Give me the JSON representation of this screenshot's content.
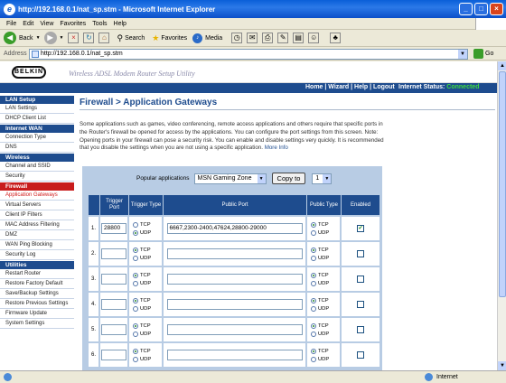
{
  "window": {
    "title": "http://192.168.0.1/nat_sp.stm - Microsoft Internet Explorer",
    "min": "_",
    "max": "□",
    "close": "×"
  },
  "menu": [
    "File",
    "Edit",
    "View",
    "Favorites",
    "Tools",
    "Help"
  ],
  "toolbar": {
    "back": "Back",
    "search": "Search",
    "favorites": "Favorites",
    "media": "Media"
  },
  "address": {
    "label": "Address",
    "url": "http://192.168.0.1/nat_sp.stm",
    "go": "Go"
  },
  "status": {
    "zone": "Internet"
  },
  "header": {
    "brand": "BELKIN",
    "utility": "Wireless ADSL Modem Router Setup Utility",
    "nav": "Home | Wizard | Help | Logout",
    "internet_status_label": "Internet Status:",
    "internet_status_value": "Connected"
  },
  "sidebar": [
    {
      "type": "head",
      "label": "LAN Setup"
    },
    {
      "type": "item",
      "label": "LAN Settings"
    },
    {
      "type": "item",
      "label": "DHCP Client List"
    },
    {
      "type": "head",
      "label": "Internet WAN"
    },
    {
      "type": "item",
      "label": "Connection Type"
    },
    {
      "type": "item",
      "label": "DNS"
    },
    {
      "type": "head",
      "label": "Wireless"
    },
    {
      "type": "item",
      "label": "Channel and SSID"
    },
    {
      "type": "item",
      "label": "Security"
    },
    {
      "type": "head",
      "label": "Firewall",
      "active": true
    },
    {
      "type": "item",
      "label": "Application Gateways",
      "active": true
    },
    {
      "type": "item",
      "label": "Virtual Servers"
    },
    {
      "type": "item",
      "label": "Client IP Filters"
    },
    {
      "type": "item",
      "label": "MAC Address Filtering"
    },
    {
      "type": "item",
      "label": "DMZ"
    },
    {
      "type": "item",
      "label": "WAN Ping Blocking"
    },
    {
      "type": "item",
      "label": "Security Log"
    },
    {
      "type": "head",
      "label": "Utilities"
    },
    {
      "type": "item",
      "label": "Restart Router"
    },
    {
      "type": "item",
      "label": "Restore Factory Default"
    },
    {
      "type": "item",
      "label": "Save/Backup Settings"
    },
    {
      "type": "item",
      "label": "Restore Previous Settings"
    },
    {
      "type": "item",
      "label": "Firmware Update"
    },
    {
      "type": "item",
      "label": "System Settings"
    }
  ],
  "content": {
    "title": "Firewall > Application Gateways",
    "description": "Some applications such as games, video conferencing, remote access applications and others require that specific ports in the Router's firewall be opened for access by the applications. You can configure the port settings from this screen. Note: Opening ports in your firewall can pose a security risk. You can enable and disable settings very quickly. It is recommended that you disable the settings when you are not using a specific application.",
    "more_info": "More Info",
    "popular_label": "Popular applications",
    "popular_selected": "MSN Gaming Zone",
    "copy_button": "Copy to",
    "copy_target": "1"
  },
  "table": {
    "headers": [
      "",
      "Trigger Port",
      "Trigger Type",
      "Public Port",
      "Public Type",
      "Enabled"
    ],
    "tcp": "TCP",
    "udp": "UDP",
    "rows": [
      {
        "num": "1.",
        "trigger_port": "28800",
        "trigger_type": "UDP",
        "public_port": "6667,2300-2400,47624,28800-29000",
        "public_type": "TCP",
        "enabled": true
      },
      {
        "num": "2.",
        "trigger_port": "",
        "trigger_type": "TCP",
        "public_port": "",
        "public_type": "TCP",
        "enabled": false
      },
      {
        "num": "3.",
        "trigger_port": "",
        "trigger_type": "TCP",
        "public_port": "",
        "public_type": "TCP",
        "enabled": false
      },
      {
        "num": "4.",
        "trigger_port": "",
        "trigger_type": "TCP",
        "public_port": "",
        "public_type": "TCP",
        "enabled": false
      },
      {
        "num": "5.",
        "trigger_port": "",
        "trigger_type": "TCP",
        "public_port": "",
        "public_type": "TCP",
        "enabled": false
      },
      {
        "num": "6.",
        "trigger_port": "",
        "trigger_type": "TCP",
        "public_port": "",
        "public_type": "TCP",
        "enabled": false
      }
    ]
  }
}
